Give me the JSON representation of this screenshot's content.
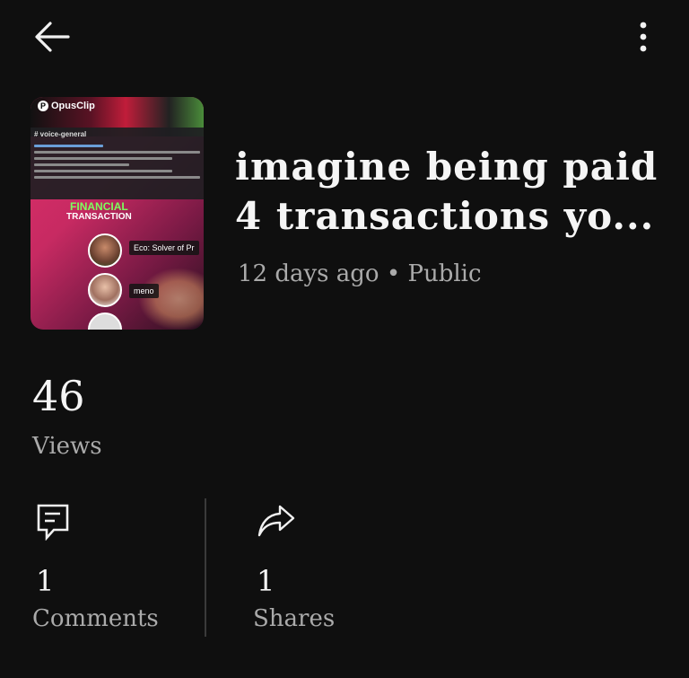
{
  "header": {
    "back_icon": "arrow-left-icon",
    "more_icon": "more-vertical-icon"
  },
  "video": {
    "title_line1": "imagine being paid",
    "title_line2": "4 transactions yo...",
    "age": "12 days ago",
    "separator": "•",
    "visibility": "Public",
    "thumbnail": {
      "brand": "OpusClip",
      "channel_label": "# voice-general",
      "headline_1": "FINANCIAL",
      "headline_2": "TRANSACTION",
      "tag_1": "Eco: Solver of Pr",
      "tag_2": "meno"
    }
  },
  "stats": {
    "views": {
      "value": "46",
      "label": "Views"
    },
    "comments": {
      "value": "1",
      "label": "Comments",
      "icon": "comment-icon"
    },
    "shares": {
      "value": "1",
      "label": "Shares",
      "icon": "share-icon"
    }
  },
  "colors": {
    "background": "#0f0f0f",
    "primary_text": "#f5f5f5",
    "secondary_text": "#aaaaaa",
    "divider": "#3a3a3a"
  }
}
